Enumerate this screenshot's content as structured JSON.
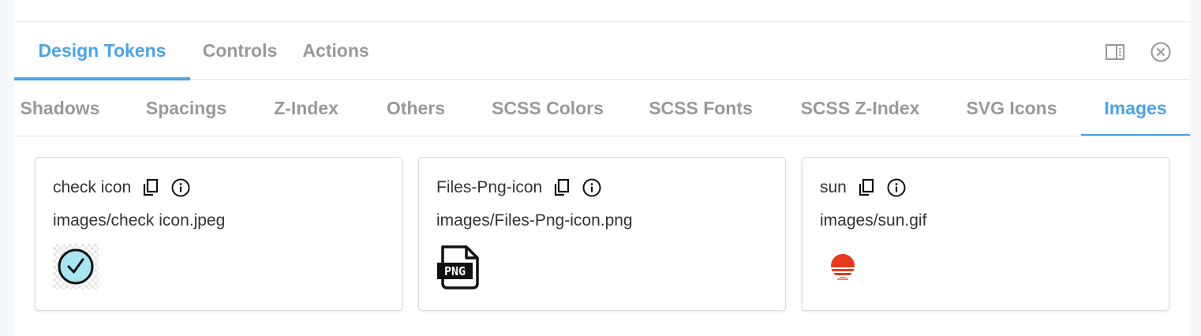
{
  "main_tabs": [
    {
      "label": "Design Tokens",
      "active": true
    },
    {
      "label": "Controls",
      "active": false
    },
    {
      "label": "Actions",
      "active": false
    }
  ],
  "toolbar": {
    "panel_toggle_icon": "panel-right-icon",
    "close_icon": "close-circle-icon"
  },
  "sub_tabs": [
    {
      "label": "Shadows",
      "active": false
    },
    {
      "label": "Spacings",
      "active": false
    },
    {
      "label": "Z-Index",
      "active": false
    },
    {
      "label": "Others",
      "active": false
    },
    {
      "label": "SCSS Colors",
      "active": false
    },
    {
      "label": "SCSS Fonts",
      "active": false
    },
    {
      "label": "SCSS Z-Index",
      "active": false
    },
    {
      "label": "SVG Icons",
      "active": false
    },
    {
      "label": "Images",
      "active": true
    }
  ],
  "cards": [
    {
      "title": "check icon",
      "path": "images/check icon.jpeg",
      "preview_icon": "check-circle-icon"
    },
    {
      "title": "Files-Png-icon",
      "path": "images/Files-Png-icon.png",
      "preview_icon": "png-file-icon",
      "preview_text": "PNG"
    },
    {
      "title": "sun",
      "path": "images/sun.gif",
      "preview_icon": "sun-icon"
    }
  ],
  "colors": {
    "accent": "#4ba3e8",
    "inactive_tab": "#999999",
    "text": "#333333",
    "check_fill": "#a8e6f0",
    "sun": "#e8391e"
  }
}
